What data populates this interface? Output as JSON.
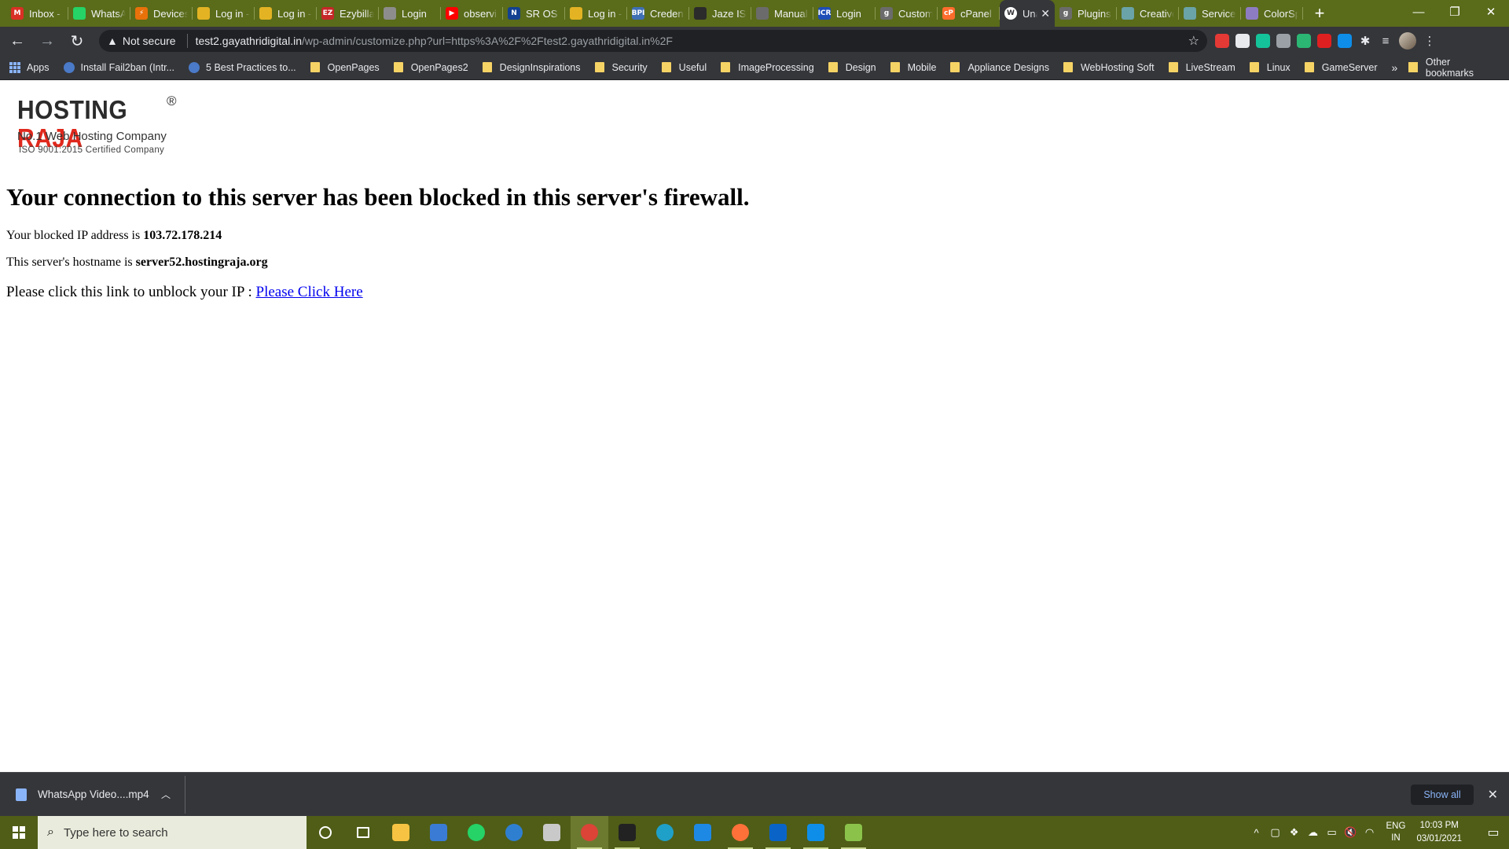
{
  "browser": {
    "tabs": [
      {
        "label": "Inbox -",
        "icon": "gmail-icon",
        "color": "#d93025",
        "glyph": "M"
      },
      {
        "label": "WhatsApp",
        "icon": "whatsapp-icon",
        "color": "#25d366",
        "glyph": ""
      },
      {
        "label": "Devices",
        "icon": "lightning-icon",
        "color": "#e8710a",
        "glyph": "⚡"
      },
      {
        "label": "Log in -",
        "icon": "wordpress-log-icon",
        "color": "#e3b324",
        "glyph": ""
      },
      {
        "label": "Log in -",
        "icon": "wordpress-log-icon",
        "color": "#e3b324",
        "glyph": ""
      },
      {
        "label": "Ezybilla",
        "icon": "ezybill-icon",
        "color": "#c62828",
        "glyph": "EZ"
      },
      {
        "label": "Login",
        "icon": "login-icon",
        "color": "#8d8d8d",
        "glyph": ""
      },
      {
        "label": "observi",
        "icon": "youtube-icon",
        "color": "#ff0000",
        "glyph": "▶"
      },
      {
        "label": "SR OS C",
        "icon": "nokia-icon",
        "color": "#124191",
        "glyph": "N"
      },
      {
        "label": "Log in -",
        "icon": "wordpress-log-icon",
        "color": "#e3b324",
        "glyph": ""
      },
      {
        "label": "Creden",
        "icon": "credentials-icon",
        "color": "#3f6fb5",
        "glyph": "BPI"
      },
      {
        "label": "Jaze ISP",
        "icon": "jaze-icon",
        "color": "#2b2b2b",
        "glyph": ""
      },
      {
        "label": "Manual",
        "icon": "manual-icon",
        "color": "#6b6b6b",
        "glyph": ""
      },
      {
        "label": "Login",
        "icon": "icr-icon",
        "color": "#1e4db7",
        "glyph": "ICR"
      },
      {
        "label": "Custom",
        "icon": "google-icon",
        "color": "#6b6b6b",
        "glyph": "g"
      },
      {
        "label": "cPanel",
        "icon": "cpanel-icon",
        "color": "#ff6c2c",
        "glyph": "cP"
      },
      {
        "label": "Una",
        "icon": "wordpress-icon",
        "color": "#ffffff",
        "glyph": "W",
        "active": true
      },
      {
        "label": "Plugins",
        "icon": "google-icon",
        "color": "#6b6b6b",
        "glyph": "g"
      },
      {
        "label": "Creative",
        "icon": "creative-icon",
        "color": "#6aa3a8",
        "glyph": ""
      },
      {
        "label": "Services",
        "icon": "services-icon",
        "color": "#6aa3a8",
        "glyph": ""
      },
      {
        "label": "ColorSp",
        "icon": "colorspace-icon",
        "color": "#8e7cc3",
        "glyph": ""
      }
    ],
    "new_tab": "+",
    "window_controls": {
      "minimize": "—",
      "restore": "❐",
      "close": "✕"
    },
    "omnibox": {
      "security_label": "Not secure",
      "url_host": "test2.gayathridigital.in",
      "url_path": "/wp-admin/customize.php?url=https%3A%2F%2Ftest2.gayathridigital.in%2F"
    },
    "extensions": [
      {
        "icon": "red-extension-icon",
        "color": "#e53935"
      },
      {
        "icon": "circle-extension-icon",
        "color": "#e8eaed"
      },
      {
        "icon": "grammarly-icon",
        "color": "#15c39a"
      },
      {
        "icon": "magnifier-extension-icon",
        "color": "#9aa0a6"
      },
      {
        "icon": "green-extension-icon",
        "color": "#2bb673"
      },
      {
        "icon": "pdf-icon",
        "color": "#e02020"
      },
      {
        "icon": "teamviewer-icon",
        "color": "#0e8ee9"
      }
    ],
    "bookmarks": [
      {
        "label": "Apps",
        "type": "apps"
      },
      {
        "label": "Install Fail2ban (Intr...",
        "type": "globe"
      },
      {
        "label": "5 Best Practices to...",
        "type": "globe"
      },
      {
        "label": "OpenPages",
        "type": "folder"
      },
      {
        "label": "OpenPages2",
        "type": "folder"
      },
      {
        "label": "DesignInspirations",
        "type": "folder"
      },
      {
        "label": "Security",
        "type": "folder"
      },
      {
        "label": "Useful",
        "type": "folder"
      },
      {
        "label": "ImageProcessing",
        "type": "folder"
      },
      {
        "label": "Design",
        "type": "folder"
      },
      {
        "label": "Mobile",
        "type": "folder"
      },
      {
        "label": "Appliance Designs",
        "type": "folder"
      },
      {
        "label": "WebHosting Soft",
        "type": "folder"
      },
      {
        "label": "LiveStream",
        "type": "folder"
      },
      {
        "label": "Linux",
        "type": "folder"
      },
      {
        "label": "GameServer",
        "type": "folder"
      }
    ],
    "bookmarks_overflow": "»",
    "other_bookmarks": "Other bookmarks"
  },
  "page": {
    "logo": {
      "word1": "HOSTING",
      "word2": "RAJA",
      "registered": "®",
      "tagline": "No.1 Web Hosting Company",
      "certification": "ISO 9001:2015 Certified Company"
    },
    "headline": "Your connection to this server has been blocked in this server's firewall.",
    "ip_prefix": "Your blocked IP address is ",
    "ip_value": "103.72.178.214",
    "hostname_prefix": "This server's hostname is ",
    "hostname_value": "server52.hostingraja.org",
    "unblock_prefix": "Please click this link to unblock your IP : ",
    "unblock_link": "Please Click Here"
  },
  "download_shelf": {
    "item_name": "WhatsApp Video....mp4",
    "show_all": "Show all"
  },
  "taskbar": {
    "search_placeholder": "Type here to search",
    "apps": [
      {
        "icon": "cortana-icon",
        "color": "transparent",
        "running": false
      },
      {
        "icon": "task-view-icon",
        "color": "transparent",
        "running": false
      },
      {
        "icon": "file-explorer-icon",
        "color": "#f6c342",
        "running": false
      },
      {
        "icon": "network-icon",
        "color": "#3a7bd5",
        "running": false
      },
      {
        "icon": "whatsapp-icon",
        "color": "#25d366",
        "running": false
      },
      {
        "icon": "skype-like-icon",
        "color": "#2f7fd1",
        "running": false
      },
      {
        "icon": "pen-icon",
        "color": "#c9c9c9",
        "running": false
      },
      {
        "icon": "chrome-icon",
        "color": "#db4437",
        "running": true,
        "active": true
      },
      {
        "icon": "vnc-icon",
        "color": "#222222",
        "running": true
      },
      {
        "icon": "edge-icon",
        "color": "#1fa0c9",
        "running": false
      },
      {
        "icon": "notes-icon",
        "color": "#1e88e5",
        "running": false
      },
      {
        "icon": "firefox-icon",
        "color": "#ff7139",
        "running": true
      },
      {
        "icon": "outlook-icon",
        "color": "#0a64c8",
        "running": true
      },
      {
        "icon": "teamviewer-icon",
        "color": "#0e8ee9",
        "running": true
      },
      {
        "icon": "notepadpp-icon",
        "color": "#8bc34a",
        "running": true
      }
    ],
    "language_top": "ENG",
    "language_bottom": "IN",
    "time": "10:03 PM",
    "date": "03/01/2021"
  }
}
